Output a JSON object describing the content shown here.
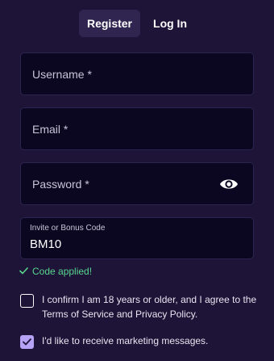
{
  "tabs": [
    {
      "label": "Register",
      "active": true
    },
    {
      "label": "Log In",
      "active": false
    }
  ],
  "fields": {
    "username_label": "Username *",
    "email_label": "Email *",
    "password_label": "Password *",
    "invite_label": "Invite or Bonus Code",
    "invite_value": "BM10"
  },
  "code_status": "Code applied!",
  "age_confirm": {
    "text": "I confirm I am 18 years or older, and I agree to the Terms of Service and Privacy Policy.",
    "checked": false
  },
  "marketing": {
    "text": "I'd like to receive marketing messages.",
    "checked": true
  },
  "icons": [
    "eye-icon",
    "checkmark-icon"
  ],
  "colors": {
    "background": "#1e1438",
    "field_bg": "#0b0720",
    "success": "#58d68d",
    "accent": "#b7a3f5"
  }
}
